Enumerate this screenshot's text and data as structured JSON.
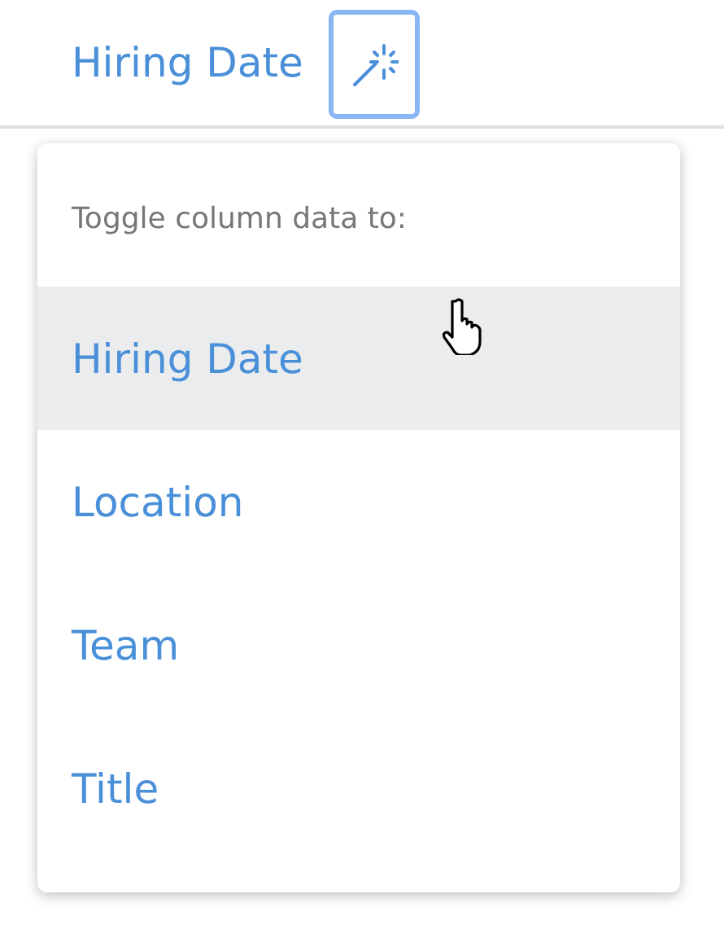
{
  "column_header": {
    "label": "Hiring Date",
    "magic_button_active": true
  },
  "menu": {
    "heading": "Toggle column data to:",
    "items": [
      {
        "label": "Hiring Date",
        "selected": true
      },
      {
        "label": "Location",
        "selected": false
      },
      {
        "label": "Team",
        "selected": false
      },
      {
        "label": "Title",
        "selected": false
      }
    ]
  }
}
